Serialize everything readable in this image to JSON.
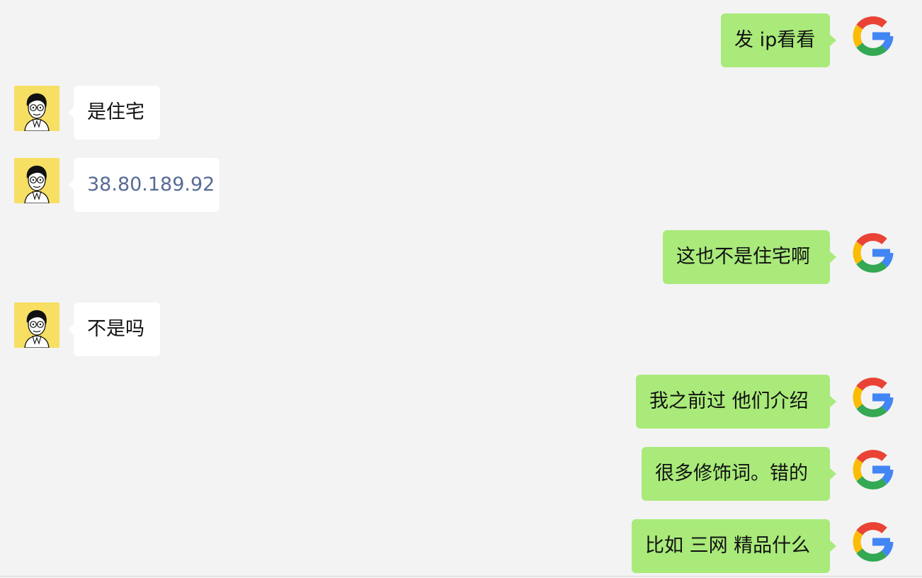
{
  "messages": [
    {
      "side": "outgoing",
      "text": "发 ip看看"
    },
    {
      "side": "incoming",
      "text": "是住宅"
    },
    {
      "side": "incoming",
      "text": "38.80.189.92"
    },
    {
      "side": "outgoing",
      "text": "这也不是住宅啊"
    },
    {
      "side": "incoming",
      "text": "不是吗"
    },
    {
      "side": "outgoing",
      "text": "我之前过 他们介绍"
    },
    {
      "side": "outgoing",
      "text": "很多修饰词。错的"
    },
    {
      "side": "outgoing",
      "text": "比如 三网 精品什么"
    }
  ],
  "avatars": {
    "incoming": "cartoon-man-avatar",
    "outgoing": "google-g-avatar"
  },
  "colors": {
    "background": "#f3f3f3",
    "incoming_bubble": "#ffffff",
    "outgoing_bubble": "#a9ea7a",
    "link": "#576b95",
    "avatar_bg": "#f6df63"
  }
}
